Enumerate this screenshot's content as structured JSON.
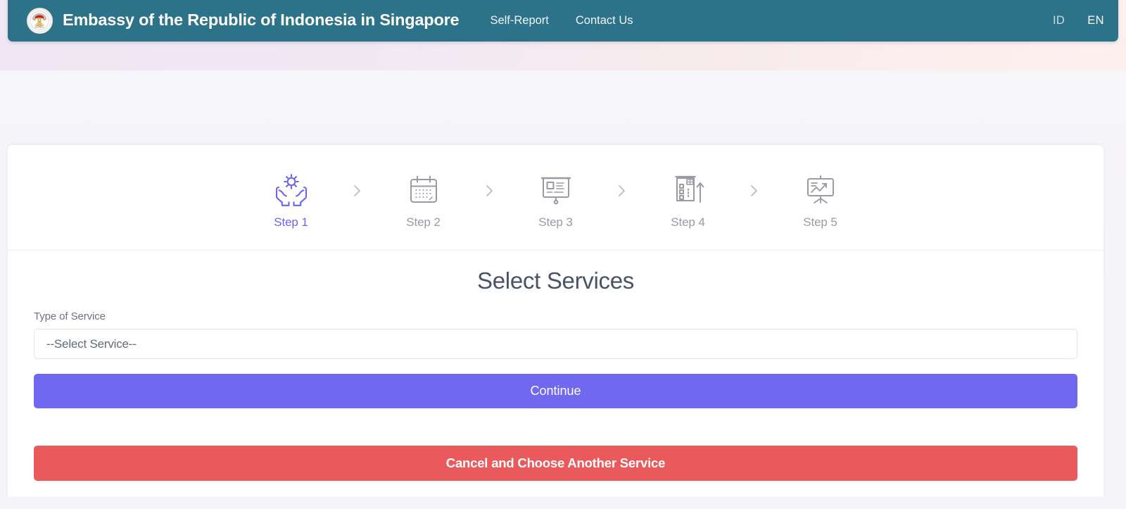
{
  "header": {
    "logo_icon": "indonesia-garuda-emblem",
    "title": "Embassy of the Republic of Indonesia in Singapore",
    "nav": [
      {
        "label": "Self-Report"
      },
      {
        "label": "Contact Us"
      }
    ],
    "languages": [
      {
        "code": "ID",
        "active": false
      },
      {
        "code": "EN",
        "active": true
      }
    ]
  },
  "stepper": {
    "separator_icon": "chevron-right-icon",
    "steps": [
      {
        "label": "Step 1",
        "icon": "hands-holding-gear-icon",
        "active": true
      },
      {
        "label": "Step 2",
        "icon": "calendar-icon",
        "active": false
      },
      {
        "label": "Step 3",
        "icon": "presentation-board-icon",
        "active": false
      },
      {
        "label": "Step 4",
        "icon": "checklist-upload-icon",
        "active": false
      },
      {
        "label": "Step 5",
        "icon": "growth-chart-easel-icon",
        "active": false
      }
    ]
  },
  "form": {
    "title": "Select Services",
    "service_label": "Type of Service",
    "service_value": "--Select Service--",
    "continue_label": "Continue",
    "cancel_label": "Cancel and Choose Another Service"
  },
  "colors": {
    "header_bg": "#2c7289",
    "accent_purple": "#6c63f5",
    "primary_button": "#7068ee",
    "danger_button": "#ea5a5d",
    "step_inactive": "#9a9aa5",
    "page_bg": "#f5f5f8"
  }
}
